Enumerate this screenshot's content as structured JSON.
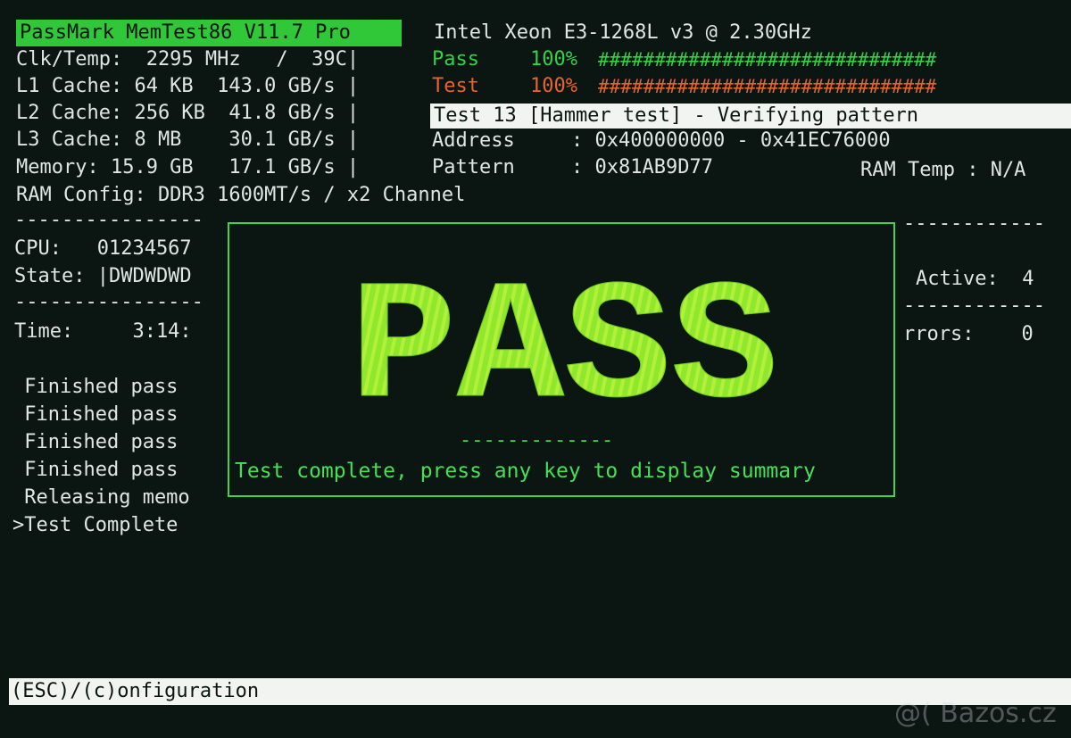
{
  "header": {
    "title": "PassMark MemTest86 V11.7 Pro",
    "cpu_name": "Intel Xeon E3-1268L v3 @ 2.30GHz"
  },
  "sysinfo": {
    "clk_temp": "Clk/Temp:  2295 MHz   /  39C|",
    "l1": "L1 Cache: 64 KB  143.0 GB/s |",
    "l2": "L2 Cache: 256 KB  41.8 GB/s |",
    "l3": "L3 Cache: 8 MB    30.1 GB/s |",
    "memory": "Memory: 15.9 GB   17.1 GB/s |",
    "ram_config": "RAM Config: DDR3 1600MT/s / x2 Channel"
  },
  "progress": {
    "pass_label": "Pass",
    "pass_pct": "100%",
    "pass_bar": "##############################",
    "test_label": "Test",
    "test_pct": "100%",
    "test_bar": "##############################"
  },
  "current_test": {
    "name": "Test 13 [Hammer test] - Verifying pattern",
    "address_label": "Address",
    "address_value": ": 0x400000000 - 0x41EC76000",
    "pattern_label": "Pattern",
    "pattern_value": ": 0x81AB9D77",
    "ram_temp": "RAM Temp : N/A"
  },
  "cpu_state": {
    "cpu_row": "CPU:   01234567",
    "state_row": "State: |DWDWDWD",
    "active_row": "Active:  4"
  },
  "timing": {
    "time_row": "Time:     3:14:",
    "errors_row": "rrors:    0"
  },
  "log": [
    " Finished pass",
    " Finished pass",
    " Finished pass",
    " Finished pass",
    " Releasing memo",
    ">Test Complete"
  ],
  "dividers": {
    "left": "----------------",
    "right": "------------"
  },
  "overlay": {
    "big_text": "PASS",
    "dashes": "-------------",
    "message": "Test complete, press any key to display summary"
  },
  "footer": {
    "menu": "(ESC)/(c)onfiguration"
  },
  "watermark": "@( Bazos.cz",
  "colors": {
    "title_bg": "#30c838",
    "pass_green": "#34d04a",
    "test_orange": "#e8642a",
    "background": "#0b1613"
  }
}
